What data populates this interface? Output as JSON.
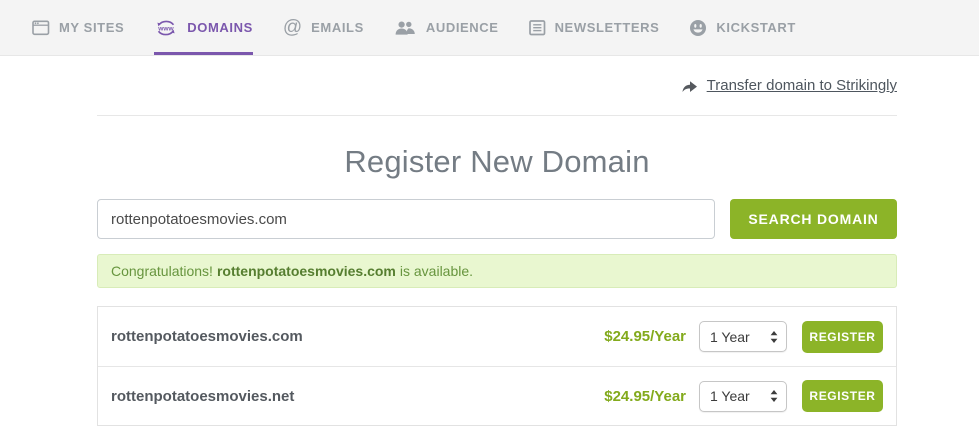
{
  "colors": {
    "accent-green": "#8cb428",
    "price-green": "#83aa1c",
    "active-purple": "#7b57ad",
    "banner-bg": "#e9f7d0",
    "banner-border": "#d8ecb8",
    "banner-text": "#67953e"
  },
  "nav": {
    "items": [
      {
        "label": "MY SITES"
      },
      {
        "label": "DOMAINS"
      },
      {
        "label": "EMAILS"
      },
      {
        "label": "AUDIENCE"
      },
      {
        "label": "NEWSLETTERS"
      },
      {
        "label": "KICKSTART"
      }
    ]
  },
  "header": {
    "transfer_link": "Transfer domain to Strikingly"
  },
  "main": {
    "title": "Register New Domain",
    "search": {
      "value": "rottenpotatoesmovies.com",
      "button": "SEARCH DOMAIN"
    },
    "banner": {
      "prefix": "Congratulations!",
      "domain": "rottenpotatoesmovies.com",
      "suffix": "is available."
    },
    "results": [
      {
        "domain": "rottenpotatoesmovies.com",
        "price": "$24.95/Year",
        "term": "1 Year",
        "action": "REGISTER"
      },
      {
        "domain": "rottenpotatoesmovies.net",
        "price": "$24.95/Year",
        "term": "1 Year",
        "action": "REGISTER"
      }
    ]
  }
}
